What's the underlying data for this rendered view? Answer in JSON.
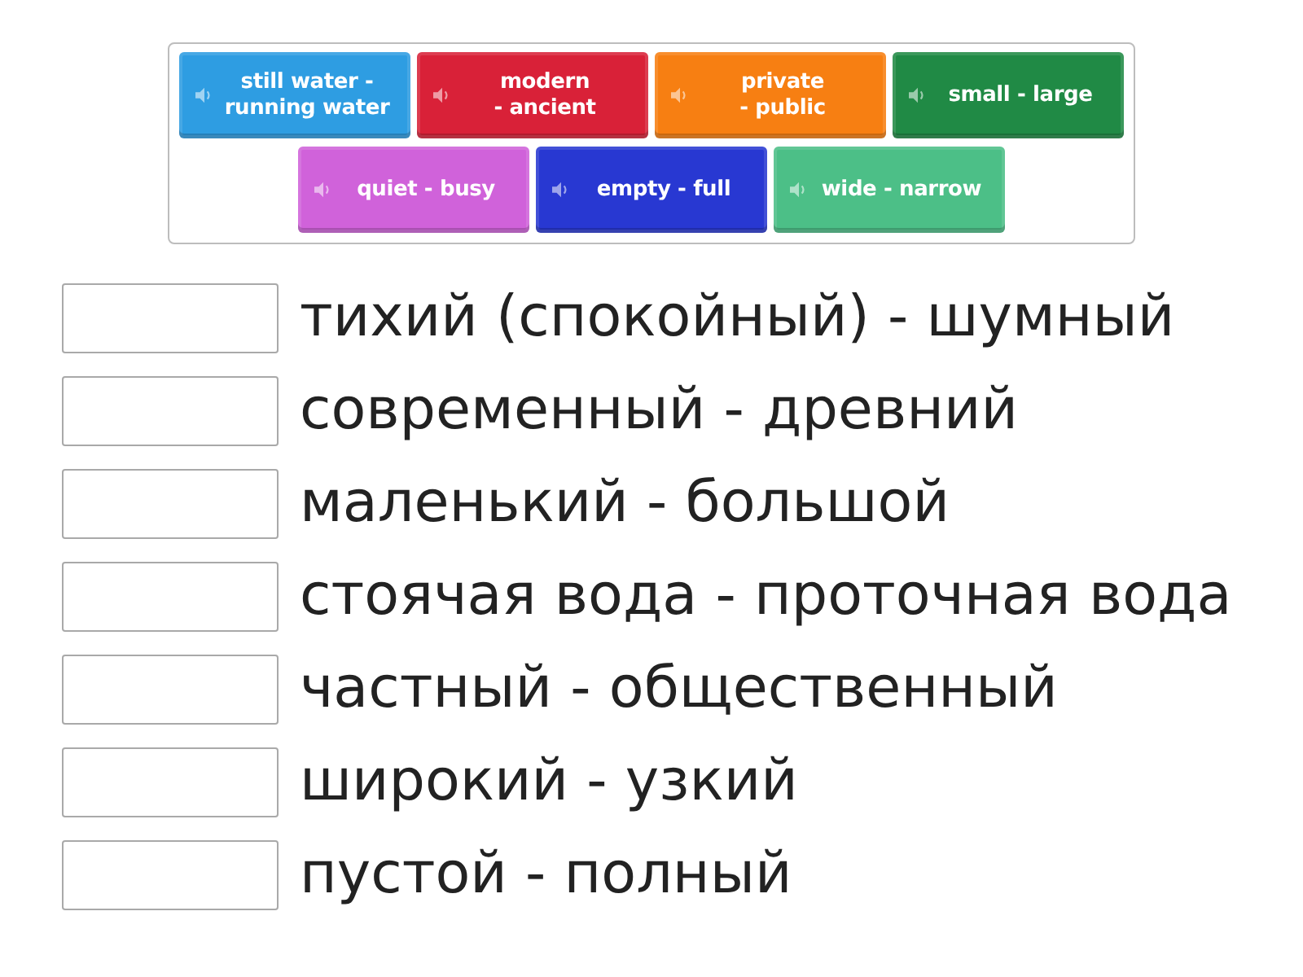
{
  "tiles": [
    {
      "label": "still water -\nrunning water",
      "color": "#2e9de2"
    },
    {
      "label": "modern\n- ancient",
      "color": "#d92138"
    },
    {
      "label": "private\n- public",
      "color": "#f77f12"
    },
    {
      "label": "small - large",
      "color": "#208a45"
    },
    {
      "label": "quiet - busy",
      "color": "#d062da"
    },
    {
      "label": "empty - full",
      "color": "#2838d2"
    },
    {
      "label": "wide - narrow",
      "color": "#4cbf87"
    }
  ],
  "answers": [
    {
      "text": "тихий (спокойный) - шумный"
    },
    {
      "text": "современный - древний"
    },
    {
      "text": "маленький - большой"
    },
    {
      "text": "стоячая вода - проточная вода"
    },
    {
      "text": "частный - общественный"
    },
    {
      "text": "широкий - узкий"
    },
    {
      "text": "пустой - полный"
    }
  ]
}
